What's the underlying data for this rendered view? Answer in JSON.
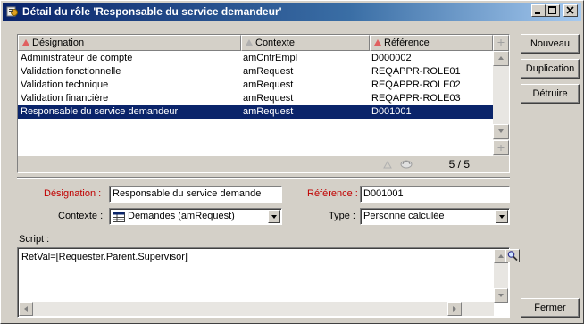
{
  "window": {
    "title": "Détail du rôle 'Responsable du service demandeur'",
    "controls": [
      "_",
      "□",
      "×"
    ]
  },
  "list": {
    "columns": [
      "Désignation",
      "Contexte",
      "Référence"
    ],
    "rows": [
      {
        "designation": "Administrateur de compte",
        "contexte": "amCntrEmpl",
        "reference": "D000002"
      },
      {
        "designation": "Validation fonctionnelle",
        "contexte": "amRequest",
        "reference": "REQAPPR-ROLE01"
      },
      {
        "designation": "Validation technique",
        "contexte": "amRequest",
        "reference": "REQAPPR-ROLE02"
      },
      {
        "designation": "Validation financière",
        "contexte": "amRequest",
        "reference": "REQAPPR-ROLE03"
      },
      {
        "designation": "Responsable du service demandeur",
        "contexte": "amRequest",
        "reference": "D001001"
      }
    ],
    "selected_index": 4,
    "counter": "5 / 5"
  },
  "buttons": {
    "new": "Nouveau",
    "duplicate": "Duplication",
    "delete": "Détruire",
    "close": "Fermer"
  },
  "form": {
    "designation_label": "Désignation :",
    "designation_value": "Responsable du service demande",
    "reference_label": "Référence :",
    "reference_value": "D001001",
    "contexte_label": "Contexte :",
    "contexte_value": "Demandes (amRequest)",
    "type_label": "Type :",
    "type_value": "Personne calculée",
    "script_label": "Script :",
    "script_value": "RetVal=[Requester.Parent.Supervisor]"
  },
  "colors": {
    "selection": "#0a246a",
    "mandatory_label": "#c00000",
    "face": "#d4d0c8"
  },
  "icons": [
    "role-window-icon",
    "sort-ascending-icon",
    "table-icon",
    "magnifier-icon",
    "sync-icon"
  ]
}
